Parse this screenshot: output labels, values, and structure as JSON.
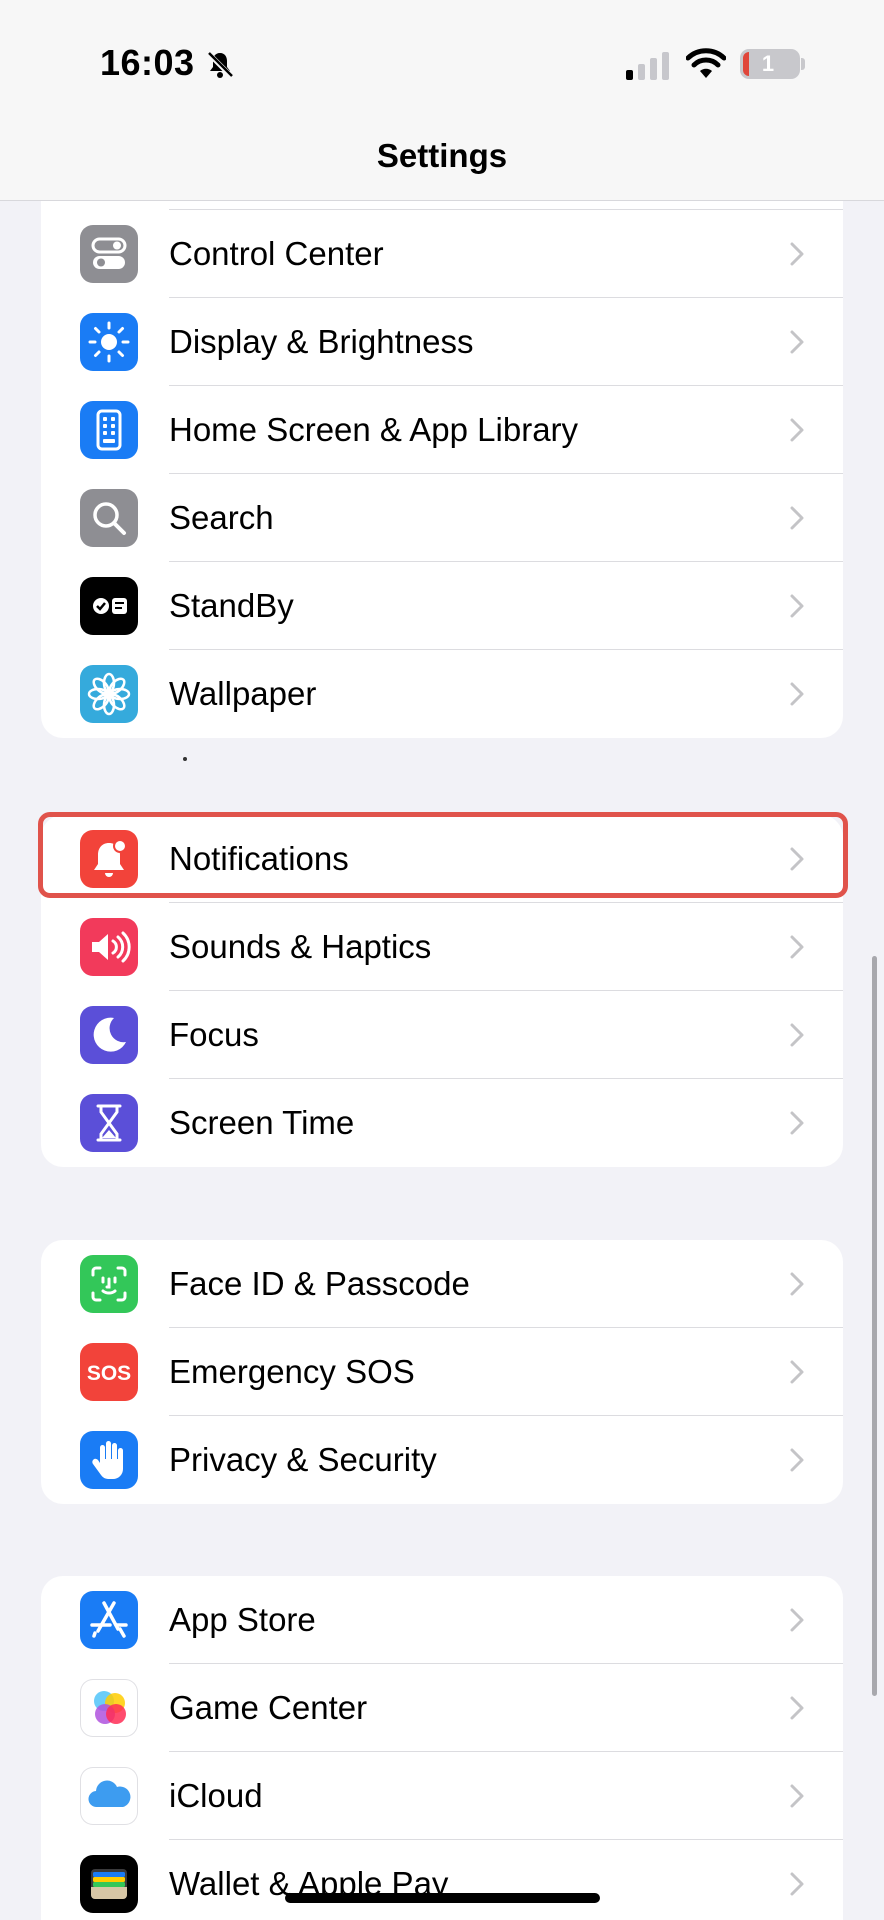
{
  "status_bar": {
    "time": "16:03",
    "battery": "1"
  },
  "header": {
    "title": "Settings"
  },
  "groups": [
    {
      "items": [
        {
          "label": "Control Center",
          "icon": "control-center-icon"
        },
        {
          "label": "Display & Brightness",
          "icon": "display-brightness-icon"
        },
        {
          "label": "Home Screen & App Library",
          "icon": "home-screen-icon"
        },
        {
          "label": "Search",
          "icon": "search-icon"
        },
        {
          "label": "StandBy",
          "icon": "standby-icon"
        },
        {
          "label": "Wallpaper",
          "icon": "wallpaper-icon"
        }
      ]
    },
    {
      "items": [
        {
          "label": "Notifications",
          "icon": "notifications-icon"
        },
        {
          "label": "Sounds & Haptics",
          "icon": "sounds-haptics-icon"
        },
        {
          "label": "Focus",
          "icon": "focus-moon-icon"
        },
        {
          "label": "Screen Time",
          "icon": "screen-time-hourglass-icon"
        }
      ]
    },
    {
      "items": [
        {
          "label": "Face ID & Passcode",
          "icon": "face-id-icon"
        },
        {
          "label": "Emergency SOS",
          "icon": "emergency-sos-icon",
          "icon_text": "SOS"
        },
        {
          "label": "Privacy & Security",
          "icon": "privacy-hand-icon"
        }
      ]
    },
    {
      "items": [
        {
          "label": "App Store",
          "icon": "app-store-icon"
        },
        {
          "label": "Game Center",
          "icon": "game-center-icon"
        },
        {
          "label": "iCloud",
          "icon": "icloud-icon"
        },
        {
          "label": "Wallet & Apple Pay",
          "icon": "wallet-icon"
        }
      ]
    }
  ],
  "colors": {
    "background": "#f2f2f7",
    "highlight": "#e0534b",
    "control_center": "#8e8e93",
    "display": "#1a7cf5",
    "home_screen": "#1a7cf5",
    "search": "#8e8e93",
    "standby": "#000000",
    "wallpaper": "#35aadc",
    "notifications": "#f2433a",
    "sounds": "#f23a5b",
    "focus": "#5b4fd8",
    "screen_time": "#5b4fd8",
    "face_id": "#33c759",
    "sos": "#f2433a",
    "privacy": "#1a7cf5",
    "app_store": "#1a7cf5",
    "wallet": "#000000"
  }
}
